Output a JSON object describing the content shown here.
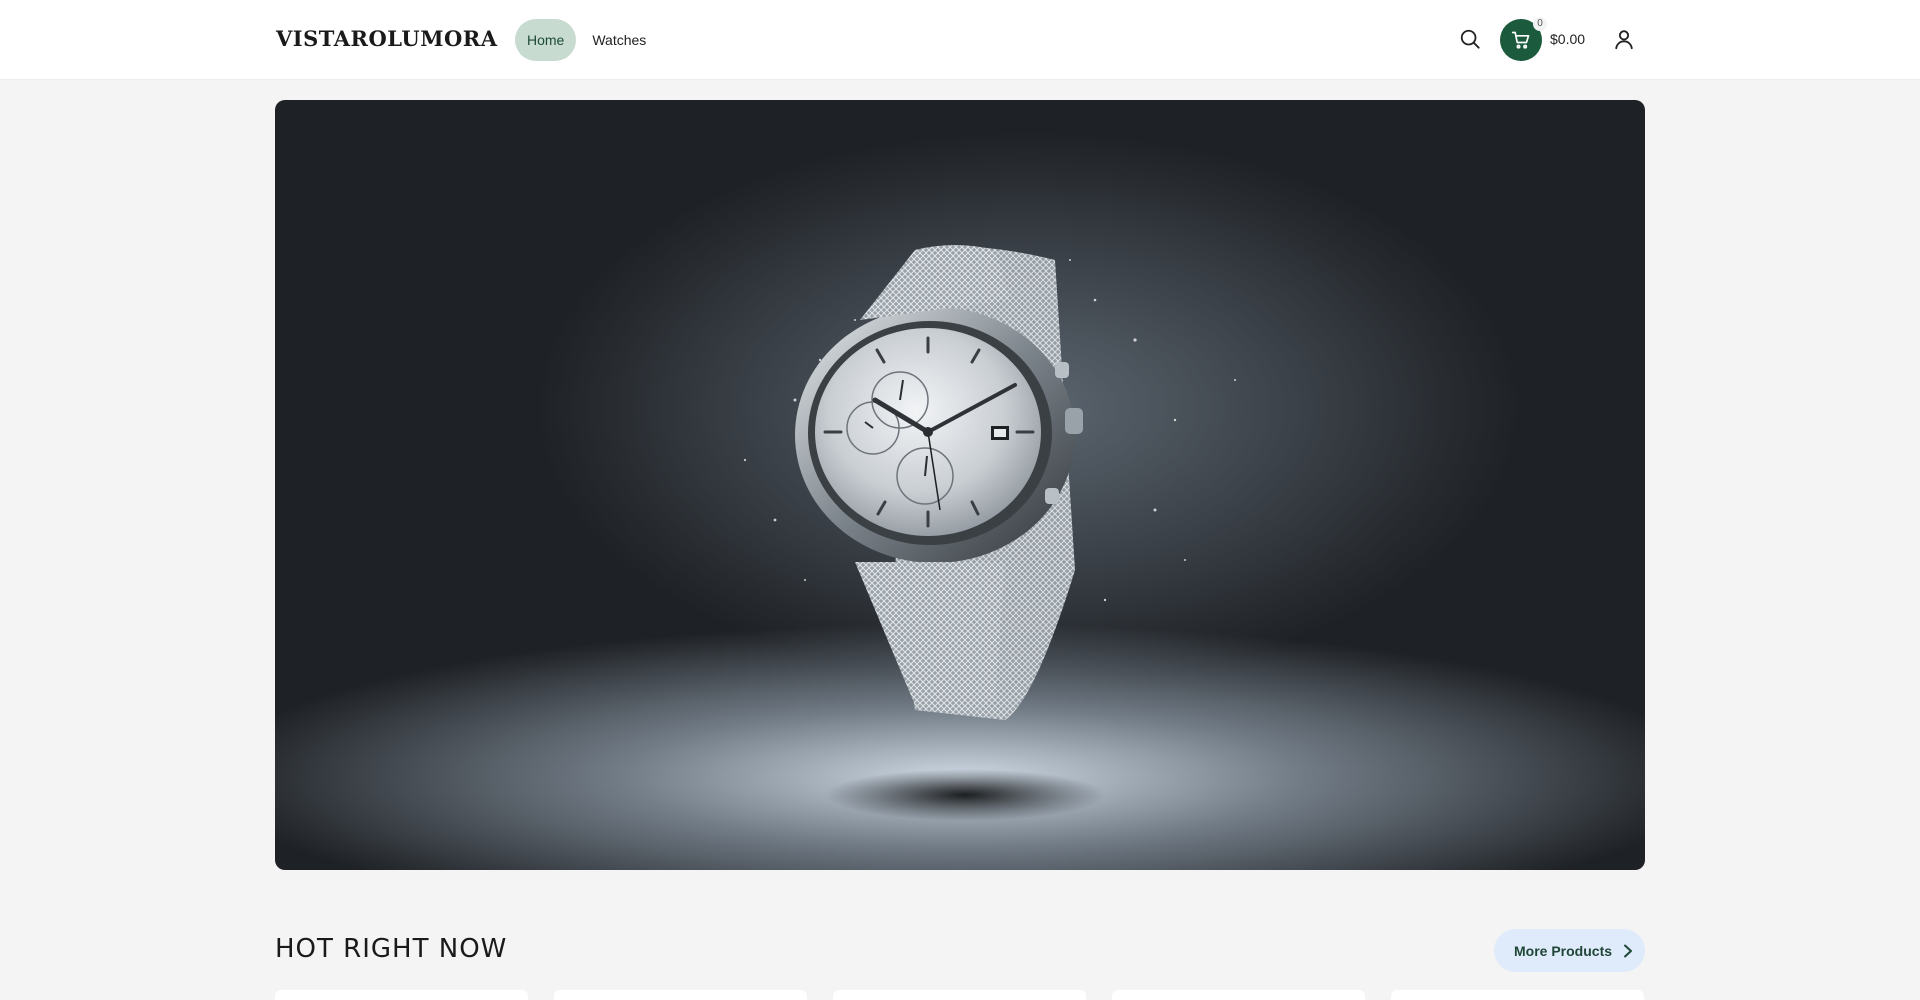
{
  "header": {
    "logo": "VISTAROLUMORA",
    "nav": [
      {
        "label": "Home",
        "active": true
      },
      {
        "label": "Watches",
        "active": false
      }
    ],
    "cart": {
      "count": "0",
      "total": "$0.00"
    },
    "icons": [
      "search-icon",
      "cart-icon",
      "account-icon"
    ]
  },
  "hero": {
    "image": "silver-chronograph-watch-mesh-strap"
  },
  "section": {
    "title": "HOT RIGHT NOW",
    "more_label": "More Products"
  },
  "colors": {
    "accent": "#1b5a3c",
    "nav_active_bg": "#c7dbd1",
    "more_button_bg": "#dfeafa",
    "page_bg": "#f4f4f4"
  }
}
